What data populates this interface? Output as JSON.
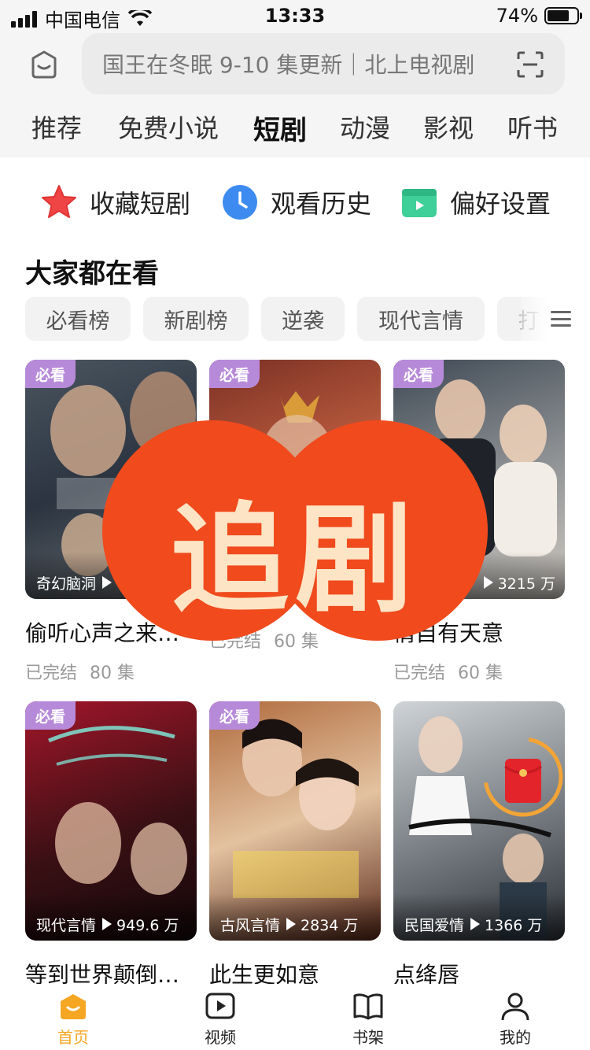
{
  "status_bar": {
    "carrier": "中国电信",
    "time": "13:33",
    "battery": "74%"
  },
  "search": {
    "placeholder": "国王在冬眠 9-10 集更新｜北上电视剧"
  },
  "tabs": [
    "推荐",
    "免费小说",
    "短剧",
    "动漫",
    "影视",
    "听书"
  ],
  "active_tab": "短剧",
  "quick_actions": [
    {
      "label": "收藏短剧",
      "icon": "star-icon"
    },
    {
      "label": "观看历史",
      "icon": "clock-icon"
    },
    {
      "label": "偏好设置",
      "icon": "settings-card-icon"
    }
  ],
  "section": {
    "title": "大家都在看"
  },
  "chips": [
    "必看榜",
    "新剧榜",
    "逆袭",
    "现代言情",
    "打"
  ],
  "cards": [
    {
      "badge": "必看",
      "genre": "奇幻脑洞",
      "views": "",
      "title": "偷听心声之来…",
      "status": "已完结",
      "episodes": "80 集"
    },
    {
      "badge": "必看",
      "genre": "",
      "views": "",
      "title": "",
      "status": "已完结",
      "episodes": "60 集"
    },
    {
      "badge": "必看",
      "genre": "",
      "views": "3215 万",
      "title": "情自有天意",
      "status": "已完结",
      "episodes": "60 集"
    },
    {
      "badge": "必看",
      "genre": "现代言情",
      "views": "949.6 万",
      "title": "等到世界颠倒…",
      "status": "",
      "episodes": ""
    },
    {
      "badge": "必看",
      "genre": "古风言情",
      "views": "2834 万",
      "title": "此生更如意",
      "status": "",
      "episodes": ""
    },
    {
      "badge": "",
      "genre": "民国爱情",
      "views": "1366 万",
      "title": "点绛唇",
      "status": "",
      "episodes": ""
    }
  ],
  "overlay": {
    "text": "追剧"
  },
  "bottom_nav": [
    {
      "label": "首页",
      "icon": "home-icon",
      "active": true
    },
    {
      "label": "视频",
      "icon": "video-icon",
      "active": false
    },
    {
      "label": "书架",
      "icon": "bookshelf-icon",
      "active": false
    },
    {
      "label": "我的",
      "icon": "profile-icon",
      "active": false
    }
  ],
  "colors": {
    "accent": "#f5a623",
    "badge": "#b78ad9",
    "overlay": "#f04a1d"
  }
}
